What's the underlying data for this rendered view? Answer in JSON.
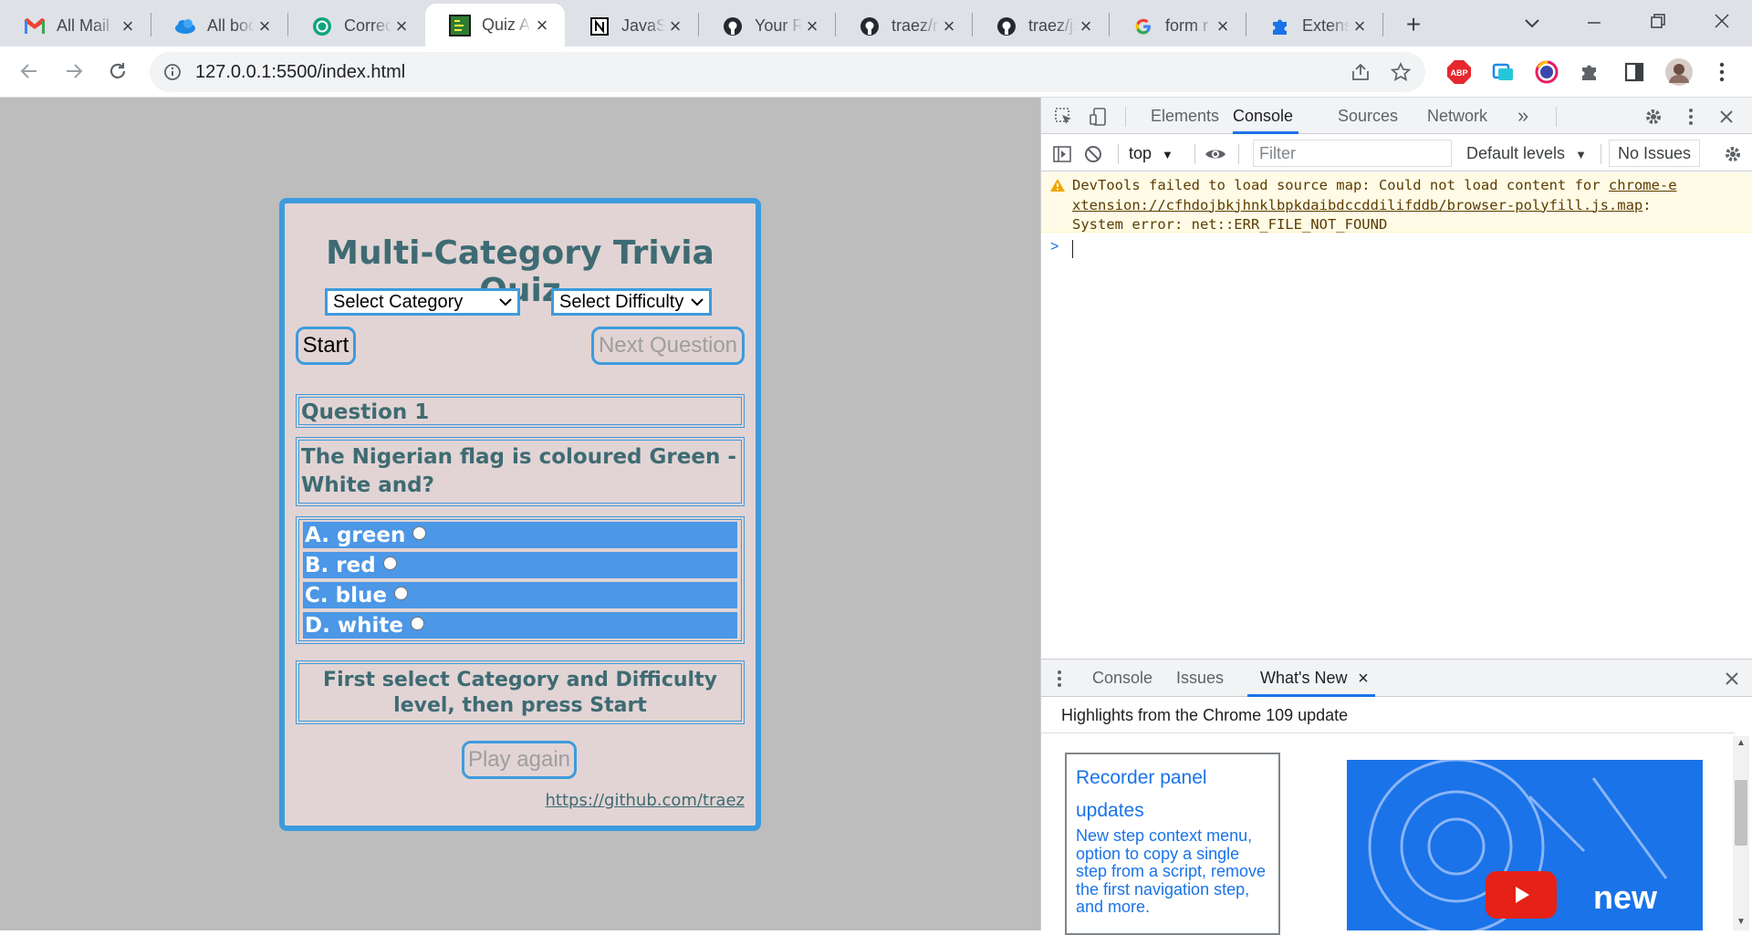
{
  "browser": {
    "tabs": [
      {
        "title": "All Mail",
        "icon": "gmail-icon"
      },
      {
        "title": "All bookmarks",
        "icon": "cloud-icon"
      },
      {
        "title": "Correct",
        "icon": "chatgpt-icon"
      },
      {
        "title": "Quiz App",
        "icon": "quiz-favicon"
      },
      {
        "title": "JavaScript",
        "icon": "notion-icon"
      },
      {
        "title": "Your Repositories",
        "icon": "github-icon"
      },
      {
        "title": "traez/r",
        "icon": "github-icon"
      },
      {
        "title": "traez/js",
        "icon": "github-icon"
      },
      {
        "title": "form r",
        "icon": "google-icon"
      },
      {
        "title": "Extensions",
        "icon": "puzzle-icon"
      }
    ],
    "active_tab_index": 3,
    "url": "127.0.0.1:5500/index.html",
    "extensions": [
      "abp-icon",
      "cast-icon",
      "color-picker-icon",
      "puzzle-icon",
      "sidebar-icon",
      "avatar"
    ],
    "abp_label": "ABP"
  },
  "quiz": {
    "title": "Multi-Category Trivia Quiz",
    "category_select": "Select Category",
    "difficulty_select": "Select Difficulty",
    "start_label": "Start",
    "next_label": "Next Question",
    "question_number": "Question 1",
    "question_text": "The Nigerian flag is coloured Green - White and?",
    "options": [
      "A. green",
      "B. red",
      "C. blue",
      "D. white"
    ],
    "status_message": "First select Category and Difficulty level, then press Start",
    "play_again_label": "Play again",
    "footer_link": "https://github.com/traez"
  },
  "devtools": {
    "tabs": [
      "Elements",
      "Console",
      "Sources",
      "Network"
    ],
    "active_tab": "Console",
    "more_tabs": "»",
    "context": "top",
    "filter_placeholder": "Filter",
    "levels": "Default levels",
    "issues": "No Issues",
    "warning": {
      "line1": "DevTools failed to load source map: Could not load content for ",
      "link": "chrome-extension://cfhdojbkjhnklbpkdaibdccddilifddb/browser-polyfill.js.map",
      "link_part1": "chrome-e",
      "link_part2": "xtension://cfhdojbkjhnklbpkdaibdccddilifddb/browser-polyfill.js.map",
      "after_link": ":",
      "line3": "System error: net::ERR_FILE_NOT_FOUND"
    },
    "prompt": ">",
    "drawer": {
      "tabs": [
        "Console",
        "Issues",
        "What's New"
      ],
      "active_tab": "What's New",
      "highlight": "Highlights from the Chrome 109 update",
      "card_title": "Recorder panel updates",
      "card_body": "New step context menu, option to copy a single step from a script, remove the first navigation step, and more.",
      "video_text": "new"
    }
  },
  "colors": {
    "accent": "#3d9bdd",
    "quiz_bg": "#e2d4d4",
    "text_teal": "#3e6b73",
    "option_bg": "#4c97e6",
    "page_bg": "#bdbdbd",
    "devtools_blue": "#1a73e8"
  }
}
